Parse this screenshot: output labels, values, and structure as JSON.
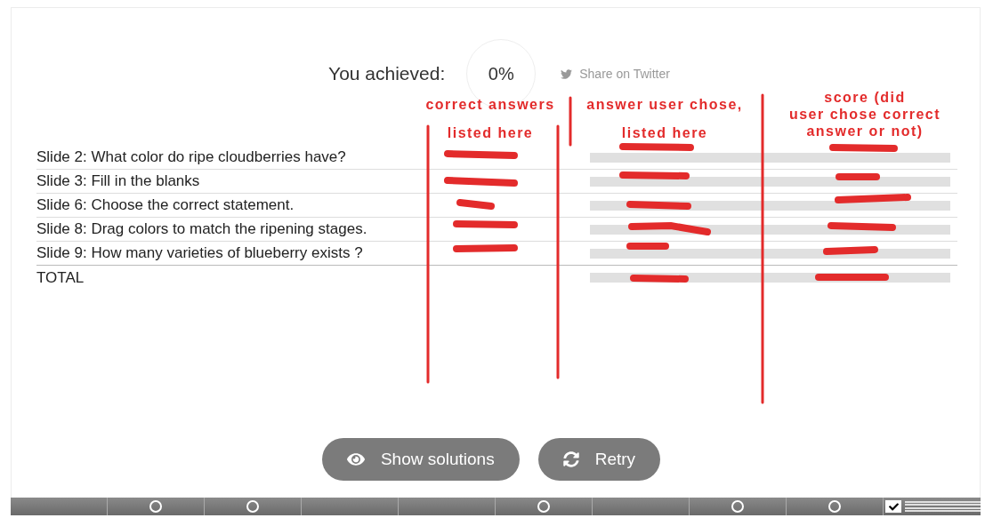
{
  "result": {
    "label": "You achieved:",
    "score": "0%",
    "share": "Share on Twitter"
  },
  "rows": [
    {
      "question": "Slide 2: What color do ripe cloudberries have?"
    },
    {
      "question": "Slide 3: Fill in the blanks"
    },
    {
      "question": "Slide 6: Choose the correct statement."
    },
    {
      "question": "Slide 8: Drag colors to match the ripening stages."
    },
    {
      "question": "Slide 9: How many varieties of blueberry exists ?"
    }
  ],
  "total": "TOTAL",
  "buttons": [
    {
      "label": "Show solutions",
      "kind": "solutions"
    },
    {
      "label": "Retry",
      "kind": "retry"
    }
  ],
  "progress": [
    {
      "kind": "blank"
    },
    {
      "kind": "task"
    },
    {
      "kind": "task"
    },
    {
      "kind": "blank"
    },
    {
      "kind": "blank"
    },
    {
      "kind": "task"
    },
    {
      "kind": "blank"
    },
    {
      "kind": "task"
    },
    {
      "kind": "task"
    },
    {
      "kind": "summary"
    }
  ],
  "annotations": [
    {
      "text": "correct answers"
    },
    {
      "text": "listed here"
    },
    {
      "text": "answer user chose,"
    },
    {
      "text": "listed here"
    },
    {
      "text": "score (did\nuser chose correct\nanswer or not)"
    }
  ]
}
